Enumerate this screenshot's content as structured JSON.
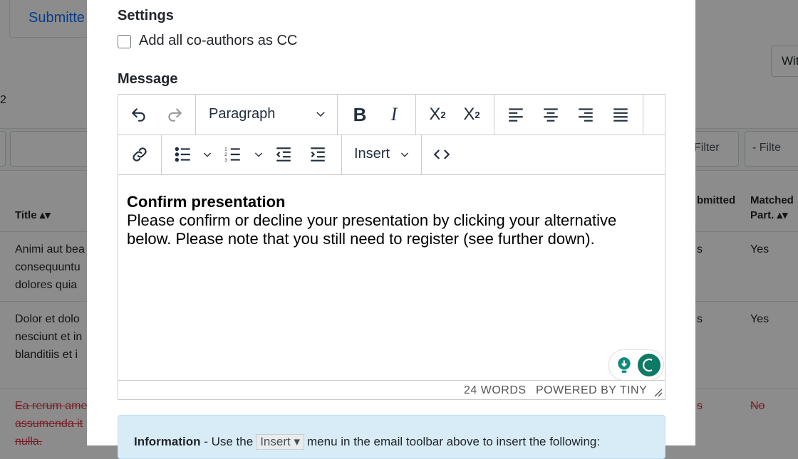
{
  "background": {
    "tab_label": "Submitte",
    "count": "2",
    "with_button": "Wit",
    "filters": [
      "Filter",
      "- Filte"
    ],
    "col_title": "Title",
    "col_submitted": "bmitted",
    "col_matched_1": "Matched",
    "col_matched_2": "Part.",
    "rows": [
      {
        "lines": [
          "Animi aut bea",
          "consequuntu",
          "dolores quia"
        ],
        "status": "s",
        "matched": "Yes",
        "struck": false
      },
      {
        "lines": [
          "Dolor et dolo",
          "nesciunt et in",
          "blanditiis et i"
        ],
        "status": "s",
        "matched": "Yes",
        "struck": false
      },
      {
        "lines": [
          "Ea rerum ame",
          "assumenda it",
          "nulla."
        ],
        "status": "s",
        "matched": "No",
        "struck": true
      }
    ]
  },
  "modal": {
    "settings_heading": "Settings",
    "cc_label": "Add all co-authors as CC",
    "message_heading": "Message",
    "toolbar": {
      "block_format": "Paragraph",
      "insert_menu": "Insert",
      "icons": [
        "undo-icon",
        "redo-icon",
        "bold-icon",
        "italic-icon",
        "subscript-icon",
        "superscript-icon",
        "align-left-icon",
        "align-center-icon",
        "align-right-icon",
        "justify-icon",
        "link-icon",
        "bullet-list-icon",
        "numbered-list-icon",
        "outdent-icon",
        "indent-icon",
        "source-code-icon"
      ]
    },
    "content": {
      "title": "Confirm presentation",
      "line1": "Please confirm or decline your presentation by clicking your alternative",
      "line2": "below. Please note that you still need to register (see further down)."
    },
    "status": {
      "word_count": "24 WORDS",
      "powered_by": "POWERED BY TINY"
    },
    "info": {
      "bold": "Information",
      "pre": " - Use the",
      "insert": "Insert",
      "post": "menu in the email toolbar above to insert the following:"
    }
  }
}
